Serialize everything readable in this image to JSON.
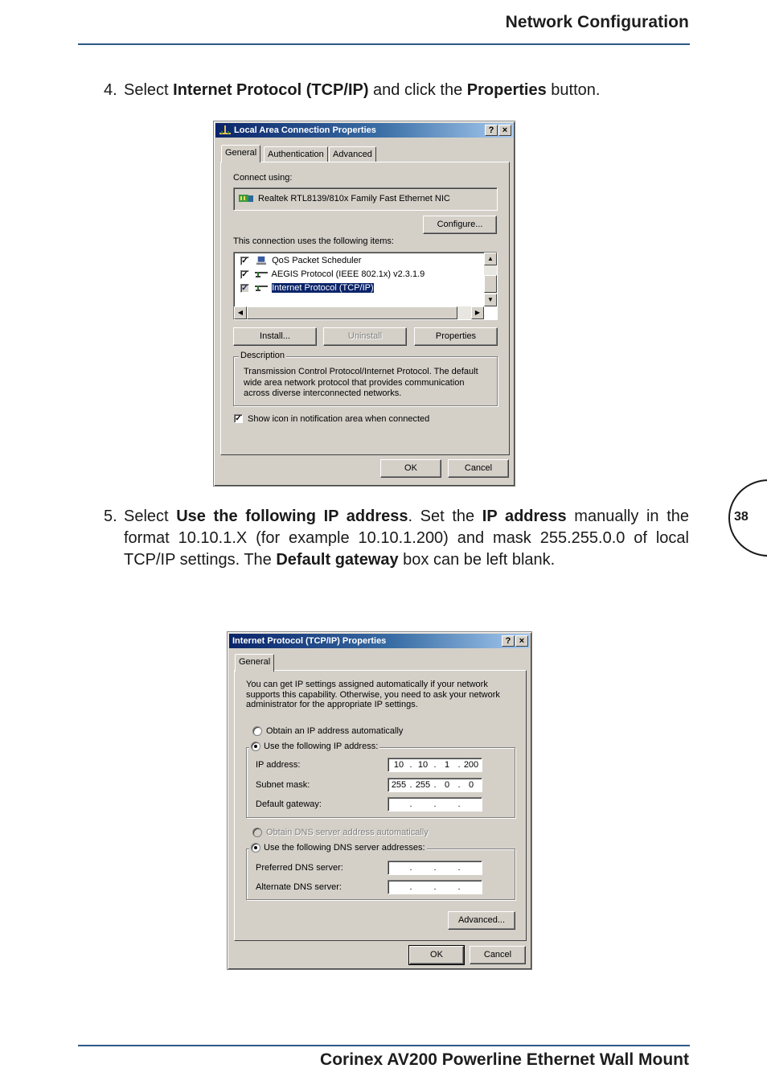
{
  "header": {
    "title": "Network Configuration"
  },
  "footer": {
    "title": "Corinex AV200 Powerline Ethernet Wall Mount"
  },
  "page_number": "38",
  "steps": [
    {
      "number": "4.",
      "parts": [
        {
          "text": "Select ",
          "bold": false
        },
        {
          "text": "Internet Protocol (TCP/IP)",
          "bold": true
        },
        {
          "text": " and click the ",
          "bold": false
        },
        {
          "text": "Properties",
          "bold": true
        },
        {
          "text": " button.",
          "bold": false
        }
      ]
    },
    {
      "number": "5.",
      "parts": [
        {
          "text": "Select ",
          "bold": false
        },
        {
          "text": "Use the following IP address",
          "bold": true
        },
        {
          "text": ". Set the ",
          "bold": false
        },
        {
          "text": "IP address",
          "bold": true
        },
        {
          "text": " manually in the format 10.10.1.X (for example 10.10.1.200) and mask 255.255.0.0 of local TCP/IP settings. The ",
          "bold": false
        },
        {
          "text": "Default gateway",
          "bold": true
        },
        {
          "text": " box can be left blank.",
          "bold": false
        }
      ]
    }
  ],
  "dialog1": {
    "title": "Local Area Connection Properties",
    "title_icon": "network-connection-icon",
    "help_button": "?",
    "close_button": "×",
    "tabs": [
      {
        "label": "General",
        "active": true
      },
      {
        "label": "Authentication",
        "active": false
      },
      {
        "label": "Advanced",
        "active": false
      }
    ],
    "connect_using_label": "Connect using:",
    "adapter": {
      "icon": "network-card-icon",
      "name": "Realtek RTL8139/810x Family Fast Ethernet NIC"
    },
    "configure_button": "Configure...",
    "items_label": "This connection uses the following items:",
    "items": [
      {
        "label": "QoS Packet Scheduler",
        "checked": true,
        "selected": false,
        "icon": "scheduler-icon"
      },
      {
        "label": "AEGIS Protocol (IEEE 802.1x) v2.3.1.9",
        "checked": true,
        "selected": false,
        "icon": "protocol-icon"
      },
      {
        "label": "Internet Protocol (TCP/IP)",
        "checked": true,
        "selected": true,
        "icon": "protocol-icon"
      }
    ],
    "install_button": "Install...",
    "uninstall_button": "Uninstall",
    "properties_button": "Properties",
    "description_legend": "Description",
    "description_text": "Transmission Control Protocol/Internet Protocol. The default wide area network protocol that provides communication across diverse interconnected networks.",
    "show_icon_label": "Show icon in notification area when connected",
    "show_icon_checked": true,
    "ok_button": "OK",
    "cancel_button": "Cancel"
  },
  "dialog2": {
    "title": "Internet Protocol (TCP/IP) Properties",
    "help_button": "?",
    "close_button": "×",
    "tabs": [
      {
        "label": "General",
        "active": true
      }
    ],
    "intro_text": "You can get IP settings assigned automatically if your network supports this capability. Otherwise, you need to ask your network administrator for the appropriate IP settings.",
    "obtain_ip_label": "Obtain an IP address automatically",
    "obtain_ip_selected": false,
    "use_ip_label": "Use the following IP address:",
    "use_ip_selected": true,
    "ip_address_label": "IP address:",
    "ip_address": [
      "10",
      "10",
      "1",
      "200"
    ],
    "subnet_mask_label": "Subnet mask:",
    "subnet_mask": [
      "255",
      "255",
      "0",
      "0"
    ],
    "gateway_label": "Default gateway:",
    "gateway": [
      "",
      "",
      "",
      ""
    ],
    "obtain_dns_label": "Obtain DNS server address automatically",
    "obtain_dns_selected": false,
    "obtain_dns_disabled": true,
    "use_dns_label": "Use the following DNS server addresses:",
    "use_dns_selected": true,
    "preferred_dns_label": "Preferred DNS server:",
    "preferred_dns": [
      "",
      "",
      "",
      ""
    ],
    "alternate_dns_label": "Alternate DNS server:",
    "alternate_dns": [
      "",
      "",
      "",
      ""
    ],
    "advanced_button": "Advanced...",
    "ok_button": "OK",
    "cancel_button": "Cancel"
  },
  "colors": {
    "rule": "#2a5a86",
    "titlebar_start": "#0a246a",
    "titlebar_end": "#a6caf0",
    "dialog_face": "#d4d0c8",
    "selection": "#0a246a"
  }
}
